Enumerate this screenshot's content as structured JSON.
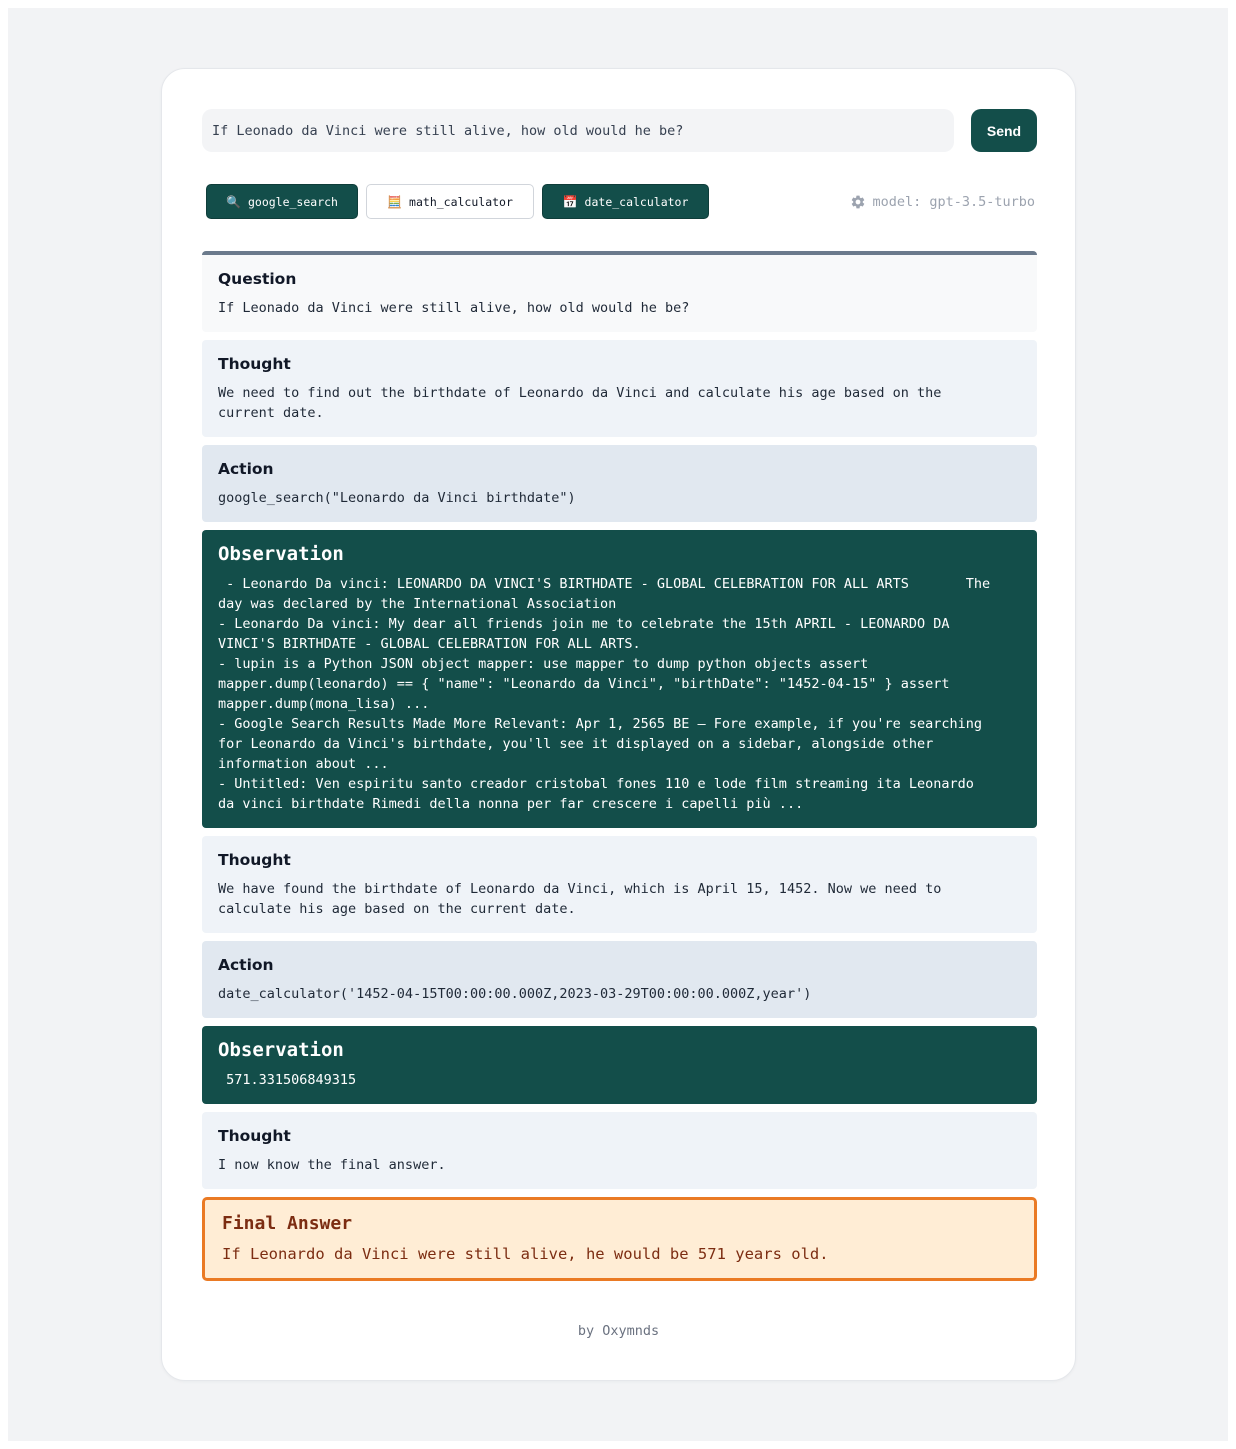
{
  "query": {
    "value": "If Leonado da Vinci were still alive, how old would he be?",
    "send_label": "Send"
  },
  "tools": [
    {
      "label": "google_search",
      "icon": "🔍",
      "icon_name": "magnifier-icon",
      "active": true
    },
    {
      "label": "math_calculator",
      "icon": "🧮",
      "icon_name": "abacus-icon",
      "active": false
    },
    {
      "label": "date_calculator",
      "icon": "📅",
      "icon_name": "calendar-icon",
      "active": true
    }
  ],
  "model": {
    "label": "model: gpt-3.5-turbo"
  },
  "steps": {
    "question": {
      "title": "Question",
      "text": "If Leonado da Vinci were still alive, how old would he be?"
    },
    "thought1": {
      "title": "Thought",
      "text": "We need to find out the birthdate of Leonardo da Vinci and calculate his age based on the\ncurrent date."
    },
    "action1": {
      "title": "Action",
      "text": "google_search(\"Leonardo da Vinci birthdate\")"
    },
    "observation1": {
      "title": "Observation",
      "text": " - Leonardo Da vinci: LEONARDO DA VINCI'S BIRTHDATE - GLOBAL CELEBRATION FOR ALL ARTS       The\nday was declared by the International Association\n- Leonardo Da vinci: My dear all friends join me to celebrate the 15th APRIL - LEONARDO DA\nVINCI'S BIRTHDATE - GLOBAL CELEBRATION FOR ALL ARTS.\n- lupin is a Python JSON object mapper: use mapper to dump python objects assert\nmapper.dump(leonardo) == { \"name\": \"Leonardo da Vinci\", \"birthDate\": \"1452-04-15\" } assert\nmapper.dump(mona_lisa) ...\n- Google Search Results Made More Relevant: Apr 1, 2565 BE — Fore example, if you're searching\nfor Leonardo da Vinci's birthdate, you'll see it displayed on a sidebar, alongside other\ninformation about ...\n- Untitled: Ven espiritu santo creador cristobal fones 110 e lode film streaming ita Leonardo\nda vinci birthdate Rimedi della nonna per far crescere i capelli più ..."
    },
    "thought2": {
      "title": "Thought",
      "text": "We have found the birthdate of Leonardo da Vinci, which is April 15, 1452. Now we need to\ncalculate his age based on the current date."
    },
    "action2": {
      "title": "Action",
      "text": "date_calculator('1452-04-15T00:00:00.000Z,2023-03-29T00:00:00.000Z,year')"
    },
    "observation2": {
      "title": "Observation",
      "text": " 571.331506849315"
    },
    "thought3": {
      "title": "Thought",
      "text": "I now know the final answer."
    },
    "final": {
      "title": "Final Answer",
      "text": "If Leonardo da Vinci were still alive, he would be 571 years old."
    }
  },
  "footer": {
    "text": "by Oxymnds"
  },
  "colors": {
    "accent": "#134e4a",
    "final_border": "#ea7a24",
    "final_bg": "#ffedd5",
    "final_text": "#7c2d12"
  }
}
